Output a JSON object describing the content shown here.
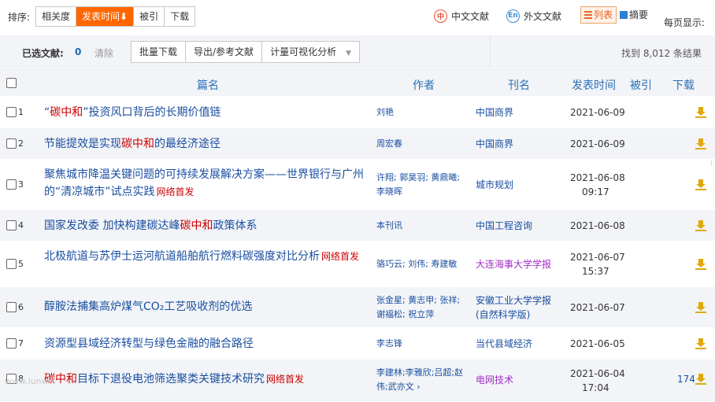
{
  "sortbar": {
    "label": "排序:",
    "options": [
      {
        "label": "相关度"
      },
      {
        "label": "发表时间",
        "arrow": "⬇"
      },
      {
        "label": "被引"
      },
      {
        "label": "下载"
      }
    ],
    "lang_cn": {
      "icon": "中",
      "label": "中文文献"
    },
    "lang_en": {
      "icon": "En",
      "label": "外文文献"
    },
    "view_list": "列表",
    "view_summary": "摘要",
    "per_page": "每页显示:"
  },
  "selbar": {
    "label": "已选文献:",
    "count": "0",
    "clear": "清除",
    "actions": [
      "批量下载",
      "导出/参考文献",
      "计量可视化分析"
    ],
    "found": "找到 8,012 条结果"
  },
  "table": {
    "headers": {
      "title": "篇名",
      "author": "作者",
      "journal": "刊名",
      "date": "发表时间",
      "cited": "被引",
      "download": "下载"
    },
    "rows": [
      {
        "num": "1",
        "t1": "“",
        "hl": "碳中和",
        "t2": "”投资风口背后的长期价值链",
        "net": "",
        "authors": "刘艳",
        "journal": "中国商界",
        "date": "2021-06-09",
        "time": "",
        "dl": ""
      },
      {
        "num": "2",
        "t1": "节能提效是实现",
        "hl": "碳中和",
        "t2": "的最经济途径",
        "net": "",
        "authors": "周宏春",
        "journal": "中国商界",
        "date": "2021-06-09",
        "time": "",
        "dl": ""
      },
      {
        "num": "3",
        "t1": "聚焦城市降温关键问题的可持续发展解决方案——世界银行与广州的“清凉城市”试点实践",
        "hl": "",
        "t2": "",
        "net": "网络首发",
        "authors": "许翔; 郭昊羽; 黄鼎曦; 李晓晖",
        "journal": "城市规划",
        "date": "2021-06-08",
        "time": "09:17",
        "dl": ""
      },
      {
        "num": "4",
        "t1": "国家发改委  加快构建碳达峰",
        "hl": "碳中和",
        "t2": "政策体系",
        "net": "",
        "authors": "本刊讯",
        "journal": "中国工程咨询",
        "date": "2021-06-08",
        "time": "",
        "dl": ""
      },
      {
        "num": "5",
        "t1": "北极航道与苏伊士运河航道船舶航行燃料碳强度对比分析",
        "hl": "",
        "t2": "",
        "net": "网络首发",
        "authors": "骆巧云; 刘伟; 寿建敏",
        "journal": "大连海事大学学报",
        "date": "2021-06-07",
        "time": "15:37",
        "dl": ""
      },
      {
        "num": "6",
        "t1": "醇胺法捕集高炉煤气CO₂工艺吸收剂的优选",
        "hl": "",
        "t2": "",
        "net": "",
        "authors": "张金星; 黄志甲; 张祥; 谢福松; 祝立萍",
        "journal": "安徽工业大学学报(自然科学版)",
        "date": "2021-06-07",
        "time": "",
        "dl": ""
      },
      {
        "num": "7",
        "t1": "资源型县域经济转型与绿色金融的融合路径",
        "hl": "",
        "t2": "",
        "net": "",
        "authors": "李志锋",
        "journal": "当代县域经济",
        "date": "2021-06-05",
        "time": "",
        "dl": ""
      },
      {
        "num": "8",
        "t1": "",
        "hl": "碳中和",
        "t2": "目标下退役电池筛选聚类关键技术研究",
        "net": "网络首发",
        "authors": "李建林;李雅欣;吕超;赵伟;武亦文 ›",
        "journal": "电网技术",
        "date": "2021-06-04",
        "time": "17:04",
        "dl": "174"
      }
    ]
  },
  "watermark": "www.lunwe",
  "colors": {
    "accent": "#ff6600",
    "link": "#1a4ea1",
    "highlight": "#cc0000",
    "download": "#e0a80b"
  }
}
